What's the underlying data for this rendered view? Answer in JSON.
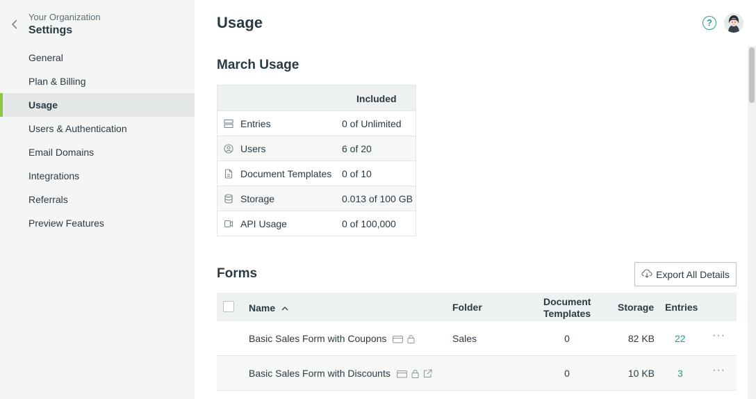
{
  "sidebar": {
    "org_name": "Your Organization",
    "title": "Settings",
    "items": [
      {
        "label": "General"
      },
      {
        "label": "Plan & Billing"
      },
      {
        "label": "Usage"
      },
      {
        "label": "Users & Authentication"
      },
      {
        "label": "Email Domains"
      },
      {
        "label": "Integrations"
      },
      {
        "label": "Referrals"
      },
      {
        "label": "Preview Features"
      }
    ]
  },
  "header": {
    "title": "Usage",
    "help_label": "?"
  },
  "usage": {
    "title": "March Usage",
    "column_header": "Included",
    "rows": [
      {
        "icon": "entries-icon",
        "label": "Entries",
        "value": "0 of Unlimited"
      },
      {
        "icon": "users-icon",
        "label": "Users",
        "value": "6 of 20"
      },
      {
        "icon": "document-icon",
        "label": "Document Templates",
        "value": "0 of 10"
      },
      {
        "icon": "database-icon",
        "label": "Storage",
        "value": "0.013 of 100 GB"
      },
      {
        "icon": "api-icon",
        "label": "API Usage",
        "value": "0 of 100,000"
      }
    ]
  },
  "forms": {
    "title": "Forms",
    "export_label": "Export All Details",
    "columns": {
      "name": "Name",
      "folder": "Folder",
      "doc_templates": "Document Templates",
      "storage": "Storage",
      "entries": "Entries"
    },
    "rows": [
      {
        "name": "Basic Sales Form with Coupons",
        "folder": "Sales",
        "doc_templates": "0",
        "storage": "82 KB",
        "entries": "22",
        "more": "···"
      },
      {
        "name": "Basic Sales Form with Discounts",
        "folder": "",
        "doc_templates": "0",
        "storage": "10 KB",
        "entries": "3",
        "more": "···"
      }
    ]
  },
  "colors": {
    "accent": "#8cc63f",
    "link": "#2a9d8f",
    "sidebar_bg": "#f4f6f6"
  }
}
